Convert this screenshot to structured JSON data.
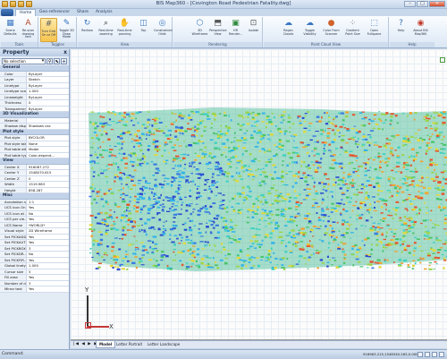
{
  "window": {
    "title": "BIS Map360 - [Covington Road Pedestrian Fatality.dwg]",
    "minimize": "–",
    "maximize": "□",
    "close": "✕"
  },
  "tabs": [
    "Home",
    "Geo-referencer",
    "Share",
    "Analysis"
  ],
  "ribbon": {
    "groups": [
      {
        "label": "Tools",
        "buttons": [
          {
            "label": "Scene Defaults",
            "icon": "scene-defaults-icon"
          },
          {
            "label": "Re-scan drawing font",
            "icon": "rescan-font-icon"
          }
        ]
      },
      {
        "label": "Toggles",
        "buttons": [
          {
            "label": "Turn Grid On or Off",
            "icon": "grid-icon"
          },
          {
            "label": "Toggle 2D Draw Mode",
            "icon": "draw-mode-icon"
          }
        ]
      },
      {
        "label": "View",
        "buttons": [
          {
            "label": "Redraw",
            "icon": "redraw-icon"
          },
          {
            "label": "Real-time zooming",
            "icon": "zoom-icon"
          },
          {
            "label": "Real-time panning",
            "icon": "pan-icon"
          },
          {
            "label": "Top",
            "icon": "top-view-icon"
          },
          {
            "label": "Constrained Orbit",
            "icon": "orbit-icon"
          }
        ]
      },
      {
        "label": "Rendering",
        "buttons": [
          {
            "label": "3D Wireframe",
            "icon": "wireframe-icon"
          },
          {
            "label": "Perspective View",
            "icon": "perspective-icon"
          },
          {
            "label": "HR Render...",
            "icon": "render-icon"
          },
          {
            "label": "Isolate",
            "icon": "isolate-icon"
          }
        ]
      },
      {
        "label": "Point Cloud View",
        "buttons": [
          {
            "label": "Regen Clouds",
            "icon": "regen-icon"
          },
          {
            "label": "Toggle Visibility",
            "icon": "visibility-icon"
          },
          {
            "label": "Color From Scanner",
            "icon": "color-scanner-icon"
          },
          {
            "label": "Gradient Point Size",
            "icon": "gradient-icon"
          },
          {
            "label": "Open Fullspace",
            "icon": "fullspace-icon"
          }
        ]
      },
      {
        "label": "Help",
        "buttons": [
          {
            "label": "Help",
            "icon": "help-icon"
          },
          {
            "label": "About BIS Map360",
            "icon": "about-icon"
          }
        ]
      }
    ]
  },
  "property_panel": {
    "title": "Property",
    "close": "x",
    "selection": "No selection",
    "categories": [
      {
        "name": "General",
        "rows": [
          [
            "Color",
            "ByLayer"
          ],
          [
            "Layer",
            "Sketch"
          ],
          [
            "Linetype",
            "ByLayer"
          ],
          [
            "Linetype scale",
            "1.000"
          ],
          [
            "Lineweight",
            "ByLayer"
          ],
          [
            "Thickness",
            "0"
          ],
          [
            "Transparency",
            "ByLayer"
          ]
        ]
      },
      {
        "name": "3D Visualization",
        "rows": [
          [
            "Material",
            ""
          ],
          [
            "Shadow displ...",
            "Shadows cas"
          ]
        ]
      },
      {
        "name": "Plot style",
        "rows": [
          [
            "Plot style",
            "BYCOLOR"
          ],
          [
            "Plot style table",
            "None"
          ],
          [
            "Plot table att...",
            "Model"
          ],
          [
            "Plot table type",
            "Color-depend..."
          ]
        ]
      },
      {
        "name": "View",
        "rows": [
          [
            "Center X",
            "916067.272"
          ],
          [
            "Center Y",
            "1548070.615"
          ],
          [
            "Center Z",
            "0"
          ],
          [
            "Width",
            "1519.983"
          ],
          [
            "Height",
            "858.287"
          ]
        ]
      },
      {
        "name": "Misc",
        "rows": [
          [
            "Annotation s...",
            "1:1"
          ],
          [
            "UCS icon On",
            "Yes"
          ],
          [
            "UCS icon at ...",
            "No"
          ],
          [
            "UCS per vie...",
            "Yes"
          ],
          [
            "UCS Name",
            "*WORLD*"
          ],
          [
            "Visual style",
            "2D Wireframe"
          ],
          [
            "Set PICKADD",
            "Yes"
          ],
          [
            "Set PICKAUTO",
            "Yes"
          ],
          [
            "Set PICKBOX",
            "3"
          ],
          [
            "Set PICKDR...",
            "No"
          ],
          [
            "Set PICKFIR...",
            "Yes"
          ],
          [
            "Global linetyp...",
            "1.000"
          ],
          [
            "Cursor size",
            "5"
          ],
          [
            "Fill area",
            "Yes"
          ],
          [
            "Number of de...",
            "3"
          ],
          [
            "Mirror text",
            "Yes"
          ]
        ]
      }
    ]
  },
  "canvas": {
    "ucs_y": "Y",
    "ucs_x": "X"
  },
  "layout_tabs": {
    "nav": "|◀ ◀ ▶ ▶|",
    "tabs": [
      "Model",
      "Letter Portrait",
      "Letter Landscape"
    ]
  },
  "status": {
    "command": "Command:",
    "coordinates": "916963.215,1548340.263,0.000"
  }
}
